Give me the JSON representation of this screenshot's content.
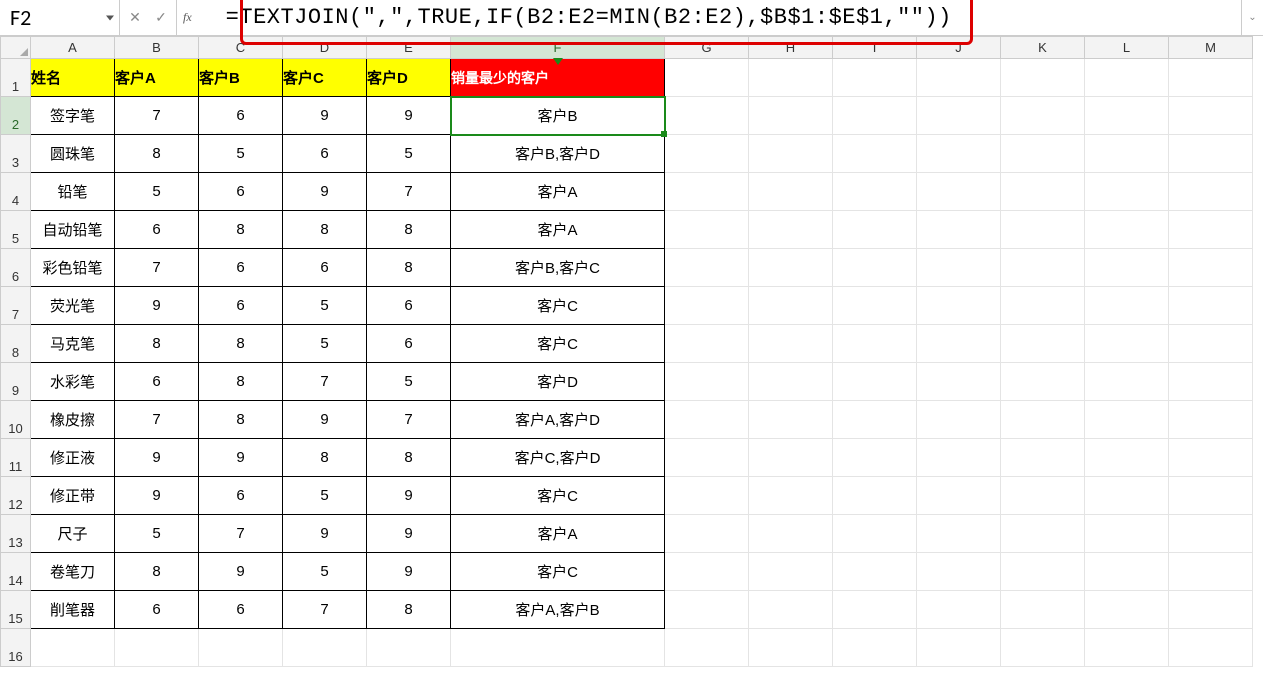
{
  "formula_bar": {
    "cell_ref": "F2",
    "cancel": "✕",
    "confirm": "✓",
    "fx": "fx",
    "formula": "=TEXTJOIN(\",\",TRUE,IF(B2:E2=MIN(B2:E2),$B$1:$E$1,\"\"))",
    "expand": "⌄"
  },
  "columns": [
    "A",
    "B",
    "C",
    "D",
    "E",
    "F",
    "G",
    "H",
    "I",
    "J",
    "K",
    "L",
    "M"
  ],
  "header": {
    "name": "姓名",
    "custA": "客户A",
    "custB": "客户B",
    "custC": "客户C",
    "custD": "客户D",
    "result": "销量最少的客户"
  },
  "rows": [
    {
      "n": "1"
    },
    {
      "n": "2",
      "name": "签字笔",
      "a": "7",
      "b": "6",
      "c": "9",
      "d": "9",
      "r": "客户B"
    },
    {
      "n": "3",
      "name": "圆珠笔",
      "a": "8",
      "b": "5",
      "c": "6",
      "d": "5",
      "r": "客户B,客户D"
    },
    {
      "n": "4",
      "name": "铅笔",
      "a": "5",
      "b": "6",
      "c": "9",
      "d": "7",
      "r": "客户A"
    },
    {
      "n": "5",
      "name": "自动铅笔",
      "a": "6",
      "b": "8",
      "c": "8",
      "d": "8",
      "r": "客户A"
    },
    {
      "n": "6",
      "name": "彩色铅笔",
      "a": "7",
      "b": "6",
      "c": "6",
      "d": "8",
      "r": "客户B,客户C"
    },
    {
      "n": "7",
      "name": "荧光笔",
      "a": "9",
      "b": "6",
      "c": "5",
      "d": "6",
      "r": "客户C"
    },
    {
      "n": "8",
      "name": "马克笔",
      "a": "8",
      "b": "8",
      "c": "5",
      "d": "6",
      "r": "客户C"
    },
    {
      "n": "9",
      "name": "水彩笔",
      "a": "6",
      "b": "8",
      "c": "7",
      "d": "5",
      "r": "客户D"
    },
    {
      "n": "10",
      "name": "橡皮擦",
      "a": "7",
      "b": "8",
      "c": "9",
      "d": "7",
      "r": "客户A,客户D"
    },
    {
      "n": "11",
      "name": "修正液",
      "a": "9",
      "b": "9",
      "c": "8",
      "d": "8",
      "r": "客户C,客户D"
    },
    {
      "n": "12",
      "name": "修正带",
      "a": "9",
      "b": "6",
      "c": "5",
      "d": "9",
      "r": "客户C"
    },
    {
      "n": "13",
      "name": "尺子",
      "a": "5",
      "b": "7",
      "c": "9",
      "d": "9",
      "r": "客户A"
    },
    {
      "n": "14",
      "name": "卷笔刀",
      "a": "8",
      "b": "9",
      "c": "5",
      "d": "9",
      "r": "客户C"
    },
    {
      "n": "15",
      "name": "削笔器",
      "a": "6",
      "b": "6",
      "c": "7",
      "d": "8",
      "r": "客户A,客户B"
    },
    {
      "n": "16"
    }
  ]
}
